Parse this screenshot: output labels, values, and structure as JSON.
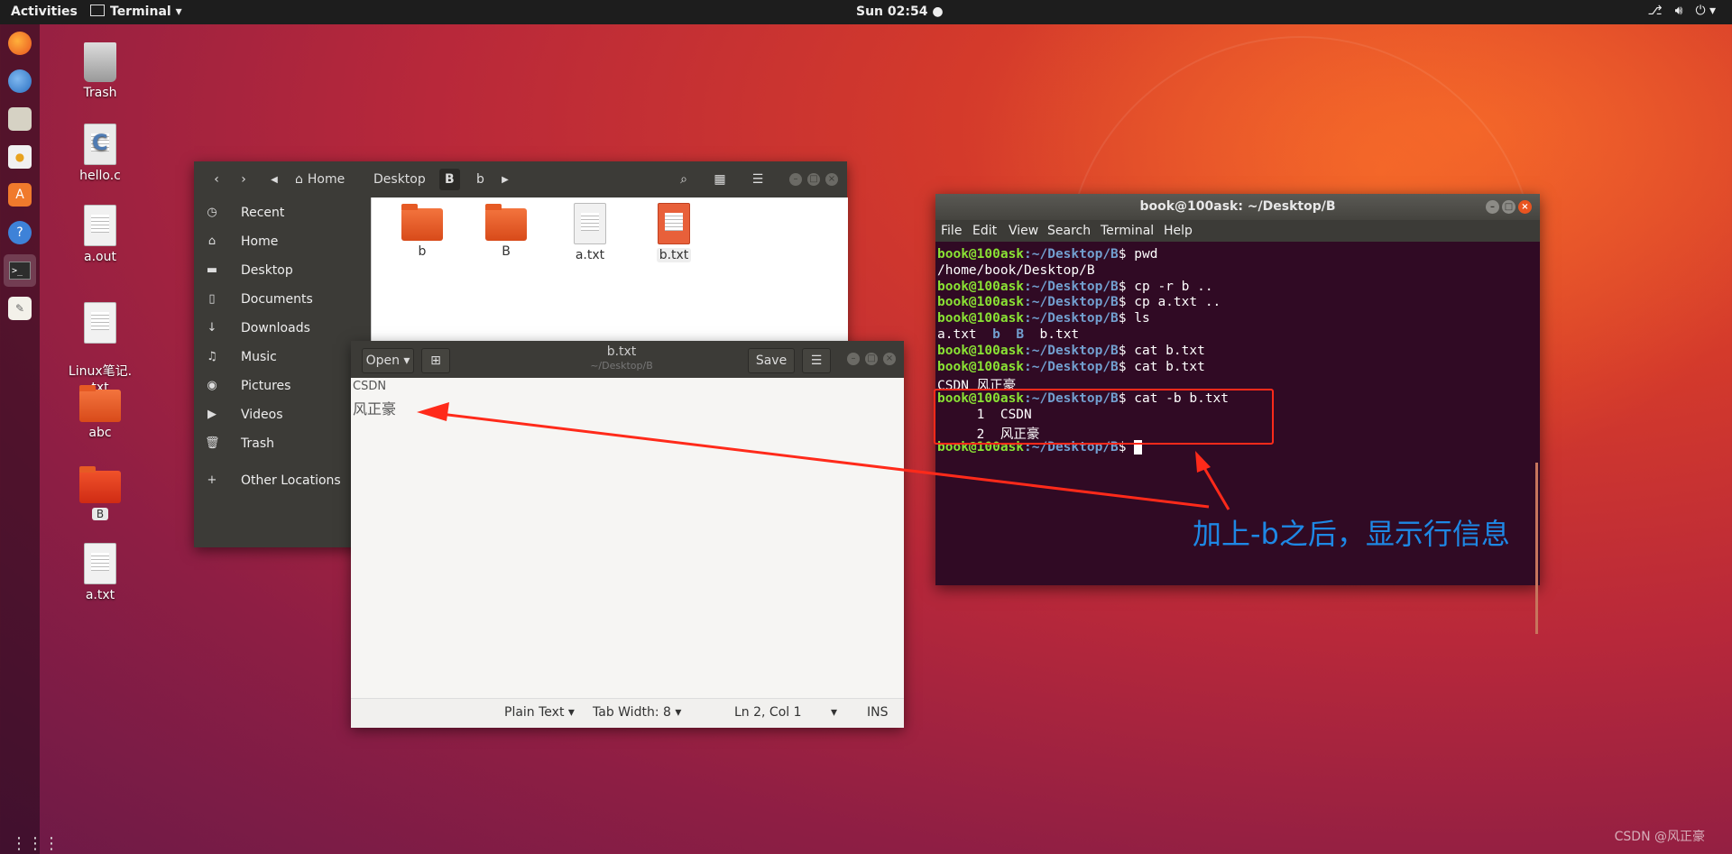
{
  "topbar": {
    "activities": "Activities",
    "app_menu": "Terminal ▾",
    "clock": "Sun 02:54 ●",
    "tray_icons": [
      "network-icon",
      "volume-icon",
      "power-icon"
    ]
  },
  "dock": {
    "apps": [
      "firefox-icon",
      "thunderbird-icon",
      "files-icon",
      "rhythmbox-icon",
      "software-icon",
      "help-icon",
      "terminal-icon",
      "text-editor-icon"
    ],
    "apps_grid": "⋮⋮⋮"
  },
  "desktop_icons": [
    {
      "label": "Trash"
    },
    {
      "label": "hello.c"
    },
    {
      "label": "a.out"
    },
    {
      "label": "Linux笔记.\ntxt"
    },
    {
      "label": "abc"
    },
    {
      "label": "B"
    },
    {
      "label": "a.txt"
    }
  ],
  "files": {
    "breadcrumb": [
      "Home",
      "Desktop",
      "B",
      "b"
    ],
    "sidebar": [
      {
        "label": "Recent"
      },
      {
        "label": "Home"
      },
      {
        "label": "Desktop"
      },
      {
        "label": "Documents"
      },
      {
        "label": "Downloads"
      },
      {
        "label": "Music"
      },
      {
        "label": "Pictures"
      },
      {
        "label": "Videos"
      },
      {
        "label": "Trash"
      },
      {
        "label": "Other Locations"
      }
    ],
    "items": [
      {
        "name": "b"
      },
      {
        "name": "B"
      },
      {
        "name": "a.txt"
      },
      {
        "name": "b.txt"
      }
    ]
  },
  "gedit": {
    "open_label": "Open ▾",
    "save_label": "Save",
    "title": "b.txt",
    "subtitle": "~/Desktop/B",
    "lines": [
      "CSDN",
      "风正豪"
    ],
    "status": {
      "language": "Plain Text ▾",
      "tab_width": "Tab Width: 8 ▾",
      "position": "Ln 2, Col 1",
      "position_arrow": "▾",
      "mode": "INS"
    }
  },
  "terminal": {
    "title": "book@100ask: ~/Desktop/B",
    "menu": [
      "File",
      "Edit",
      "View",
      "Search",
      "Terminal",
      "Help"
    ],
    "prompt_user": "book@100ask",
    "prompt_dir": ":~/Desktop/B",
    "lines": [
      {
        "type": "cmd",
        "text": " pwd"
      },
      {
        "type": "out",
        "text": "/home/book/Desktop/B"
      },
      {
        "type": "cmd",
        "text": " cp -r b .."
      },
      {
        "type": "cmd",
        "text": " cp a.txt .."
      },
      {
        "type": "cmd",
        "text": " ls"
      },
      {
        "type": "ls",
        "parts": [
          "a.txt  ",
          "b",
          "  ",
          "B",
          "  b.txt"
        ]
      },
      {
        "type": "cmd",
        "text": " cat b.txt"
      },
      {
        "type": "cmd",
        "text": " cat b.txt"
      },
      {
        "type": "out",
        "text": "CSDN 风正豪"
      },
      {
        "type": "cmd",
        "text": " cat -b b.txt"
      },
      {
        "type": "out",
        "text": "     1\tCSDN"
      },
      {
        "type": "out",
        "text": "     2\t风正豪"
      },
      {
        "type": "cmd",
        "text": " "
      }
    ]
  },
  "annotation": {
    "callout": "加上-b之后，显示行信息",
    "arrow_color": "#ff2a1a",
    "callout_color": "#1e88e5"
  },
  "watermark": "CSDN @风正豪"
}
